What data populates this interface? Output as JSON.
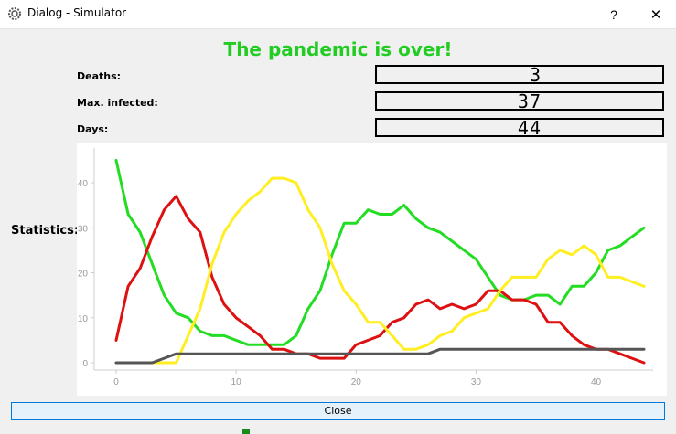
{
  "window": {
    "title": "Dialog - Simulator",
    "help_label": "?",
    "close_label": "✕"
  },
  "status_message": "The pandemic is over!",
  "metrics": [
    {
      "label": "Deaths:",
      "value": "3"
    },
    {
      "label": "Max. infected:",
      "value": "37"
    },
    {
      "label": "Days:",
      "value": "44"
    }
  ],
  "statistics_label": "Statistics:",
  "close_button_label": "Close",
  "colors": {
    "status": "#22cc22",
    "healthy": "#22dd22",
    "infected": "#dd1111",
    "recovered": "#ffee22",
    "dead": "#555555"
  },
  "chart_data": {
    "type": "line",
    "xlim": [
      0,
      44
    ],
    "ylim": [
      0,
      45
    ],
    "xticks": [
      0,
      10,
      20,
      30,
      40
    ],
    "yticks": [
      0,
      10,
      20,
      30,
      40
    ],
    "grid": false,
    "x": [
      0,
      1,
      2,
      3,
      4,
      5,
      6,
      7,
      8,
      9,
      10,
      11,
      12,
      13,
      14,
      15,
      16,
      17,
      18,
      19,
      20,
      21,
      22,
      23,
      24,
      25,
      26,
      27,
      28,
      29,
      30,
      31,
      32,
      33,
      34,
      35,
      36,
      37,
      38,
      39,
      40,
      41,
      42,
      43,
      44
    ],
    "series": [
      {
        "color": "#22dd22",
        "values": [
          45,
          33,
          29,
          22,
          15,
          11,
          10,
          7,
          6,
          6,
          5,
          4,
          4,
          4,
          4,
          6,
          12,
          16,
          24,
          31,
          31,
          34,
          33,
          33,
          35,
          32,
          30,
          29,
          27,
          25,
          23,
          19,
          15,
          14,
          14,
          15,
          15,
          13,
          17,
          17,
          20,
          25,
          26,
          28,
          30
        ]
      },
      {
        "color": "#dd1111",
        "values": [
          5,
          17,
          21,
          28,
          34,
          37,
          32,
          29,
          19,
          13,
          10,
          8,
          6,
          3,
          3,
          2,
          2,
          1,
          1,
          1,
          4,
          5,
          6,
          9,
          10,
          13,
          14,
          12,
          13,
          12,
          13,
          16,
          16,
          14,
          14,
          13,
          9,
          9,
          6,
          4,
          3,
          3,
          2,
          1,
          0
        ]
      },
      {
        "color": "#ffee22",
        "values": [
          0,
          0,
          0,
          0,
          0,
          0,
          6,
          12,
          22,
          29,
          33,
          36,
          38,
          41,
          41,
          40,
          34,
          30,
          22,
          16,
          13,
          9,
          9,
          6,
          3,
          3,
          4,
          6,
          7,
          10,
          11,
          12,
          16,
          19,
          19,
          19,
          23,
          25,
          24,
          26,
          24,
          19,
          19,
          18,
          17
        ]
      },
      {
        "color": "#555555",
        "values": [
          0,
          0,
          0,
          0,
          1,
          2,
          2,
          2,
          2,
          2,
          2,
          2,
          2,
          2,
          2,
          2,
          2,
          2,
          2,
          2,
          2,
          2,
          2,
          2,
          2,
          2,
          2,
          3,
          3,
          3,
          3,
          3,
          3,
          3,
          3,
          3,
          3,
          3,
          3,
          3,
          3,
          3,
          3,
          3,
          3
        ]
      }
    ]
  }
}
